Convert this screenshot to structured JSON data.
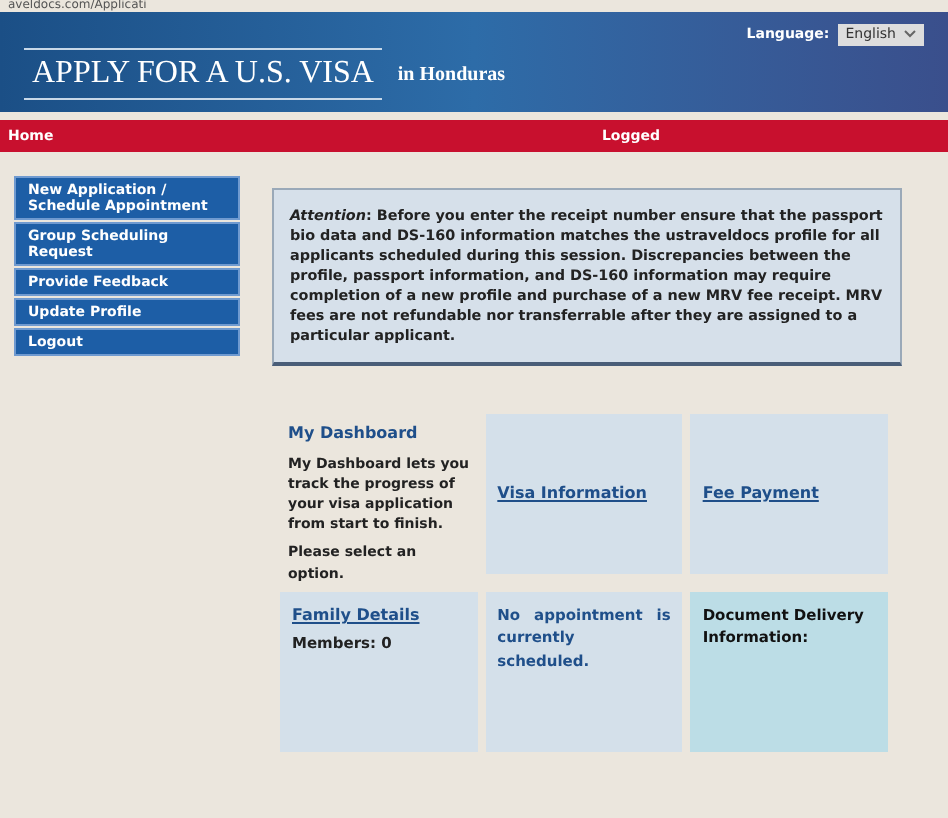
{
  "address_bar": {
    "url": "aveldocs.com/Applicati"
  },
  "header": {
    "title": "APPLY FOR A U.S. VISA",
    "subtitle": "in Honduras",
    "language_label": "Language:",
    "language_value": "English"
  },
  "nav_bar": {
    "home": "Home",
    "user": "Logged"
  },
  "sidebar": {
    "items": [
      {
        "label": "New Application / Schedule Appointment"
      },
      {
        "label": "Group Scheduling Request"
      },
      {
        "label": "Provide Feedback"
      },
      {
        "label": "Update Profile"
      },
      {
        "label": "Logout"
      }
    ]
  },
  "notice": "*Attention*: Before you enter the receipt number ensure that the passport bio data and DS-160 information matches the ustraveldocs profile for all applicants scheduled during this session. Discrepancies between the profile, passport information, and DS-160 information may require completion of a new profile and purchase of a new MRV fee receipt. MRV fees are not refundable nor transferrable after they are assigned to a particular applicant.",
  "dashboard": {
    "title": "My Dashboard",
    "description": "My Dashboard lets you track the progress of your visa application from start to finish.",
    "prompt": "Please select an option.",
    "tiles": [
      {
        "kind": "link",
        "label": "Visa Information"
      },
      {
        "kind": "link",
        "label": "Fee Payment"
      },
      {
        "kind": "link",
        "label": "Family Details",
        "detail": "Members: 0"
      },
      {
        "kind": "status",
        "label": "No appointment is currently scheduled."
      },
      {
        "kind": "info",
        "label": "Document Delivery Information:"
      }
    ]
  }
}
